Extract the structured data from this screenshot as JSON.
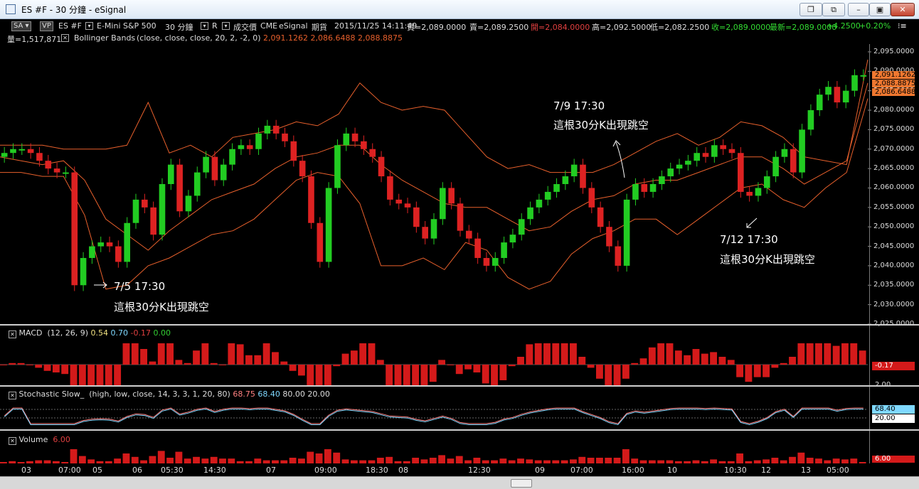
{
  "window": {
    "title": "ES #F - 30 分鐘 - eSignal"
  },
  "header": {
    "sa": "SA",
    "vp": "VP",
    "symbol": "ES #F",
    "name": "E-Mini S&P 500",
    "interval": "30 分鐘",
    "r": "R",
    "kind": "成交價",
    "exchange": "CME",
    "source": "eSignal",
    "type": "期貨",
    "datetime": "2015/11/25  14:11:49",
    "bid": "買=2,089.0000",
    "ask": "賣=2,089.2500",
    "open": "開=2,084.0000",
    "high": "高=2,092.5000",
    "low": "低=2,082.2500",
    "close": "收=2,089.0000",
    "last": "最新=2,089.0000",
    "change": "+4.2500",
    "pct": "+0.20%",
    "volume": "量=1,517,871",
    "bb_name": "Bollinger Bands",
    "bb_params": "(close, close, close, 20, 2, -2, 0)",
    "bb_values": "2,091.1262  2,086.6488  2,088.8875"
  },
  "price_axis": [
    "2,095.0000",
    "2,090.0000",
    "2,085.0000",
    "2,080.0000",
    "2,075.0000",
    "2,070.0000",
    "2,065.0000",
    "2,060.0000",
    "2,055.0000",
    "2,050.0000",
    "2,045.0000",
    "2,040.0000",
    "2,035.0000",
    "2,030.0000",
    "2,025.0000"
  ],
  "price_tags": [
    "2,091.1262",
    "2,088.8875",
    "2,086.6488"
  ],
  "annotations": [
    {
      "date": "7/5 17:30",
      "text": "這根30分K出現跳空"
    },
    {
      "date": "7/9 17:30",
      "text": "這根30分K出現跳空"
    },
    {
      "date": "7/12 17:30",
      "text": "這根30分K出現跳空"
    }
  ],
  "macd": {
    "name": "MACD",
    "params": "(12, 26, 9)",
    "v1": "0.54",
    "v2": "0.70",
    "v3": "-0.17",
    "v4": "0.00",
    "tag": "-0.17",
    "axis": "2.00"
  },
  "stoch": {
    "name": "Stochastic Slow_",
    "params": "(high, low, close, 14, 3, 3, 1, 20, 80)",
    "v1": "68.75",
    "v2": "68.40",
    "v3": "80.00",
    "v4": "20.00",
    "tag1": "68.40",
    "tag2": "20.00"
  },
  "volume_pane": {
    "name": "Volume",
    "value": "6.00",
    "tag": "6.00"
  },
  "time_axis": [
    "03",
    "07:00",
    "05",
    "06",
    "05:30",
    "14:30",
    "07",
    "09:00",
    "18:30",
    "08",
    "12:30",
    "09",
    "07:00",
    "16:00",
    "10",
    "10:30",
    "12",
    "13",
    "05:00"
  ],
  "colors": {
    "up": "#22cc22",
    "down": "#dd2222",
    "band": "#e8602c",
    "macd": "#d41a1a",
    "stoch1": "#ff8080",
    "stoch2": "#7fd8ff"
  },
  "chart_data": {
    "type": "candlestick",
    "y_range": [
      2025,
      2097
    ],
    "bands": [
      {
        "name": "upper",
        "values": [
          2071,
          2071,
          2071,
          2070,
          2070,
          2070,
          2071,
          2082,
          2069,
          2071,
          2068,
          2073,
          2074,
          2075,
          2077,
          2076,
          2079,
          2087,
          2082,
          2080,
          2081,
          2080,
          2074,
          2068,
          2065,
          2066,
          2064,
          2064,
          2064,
          2066,
          2069,
          2072,
          2074,
          2071,
          2073,
          2077,
          2076,
          2073,
          2068,
          2067,
          2066,
          2093
        ]
      },
      {
        "name": "mid",
        "values": [
          2068,
          2067,
          2066,
          2067,
          2062,
          2052,
          2048,
          2044,
          2049,
          2053,
          2057,
          2059,
          2061,
          2065,
          2068,
          2069,
          2071,
          2071,
          2066,
          2062,
          2059,
          2056,
          2055,
          2055,
          2052,
          2049,
          2050,
          2054,
          2057,
          2058,
          2061,
          2062,
          2062,
          2064,
          2066,
          2068,
          2068,
          2065,
          2061,
          2064,
          2067,
          2087
        ]
      },
      {
        "name": "lower",
        "values": [
          2064,
          2064,
          2063,
          2063,
          2053,
          2034,
          2035,
          2040,
          2042,
          2045,
          2048,
          2049,
          2052,
          2057,
          2062,
          2064,
          2063,
          2056,
          2040,
          2040,
          2042,
          2039,
          2046,
          2044,
          2037,
          2034,
          2036,
          2043,
          2047,
          2049,
          2052,
          2052,
          2048,
          2052,
          2056,
          2060,
          2061,
          2057,
          2055,
          2060,
          2064,
          2083
        ]
      }
    ],
    "closes": [
      2069,
      2070,
      2070,
      2069,
      2067,
      2065,
      2064,
      2064,
      2035,
      2042,
      2045,
      2046,
      2045,
      2041,
      2051,
      2057,
      2055,
      2048,
      2061,
      2066,
      2054,
      2058,
      2064,
      2068,
      2062,
      2066,
      2070,
      2071,
      2070,
      2074,
      2076,
      2074,
      2072,
      2067,
      2063,
      2051,
      2041,
      2060,
      2071,
      2074,
      2072,
      2070,
      2068,
      2063,
      2057,
      2056,
      2055,
      2050,
      2047,
      2052,
      2060,
      2056,
      2049,
      2047,
      2042,
      2040,
      2042,
      2046,
      2048,
      2052,
      2055,
      2057,
      2059,
      2061,
      2063,
      2066,
      2060,
      2055,
      2050,
      2045,
      2040,
      2057,
      2061,
      2059,
      2061,
      2063,
      2065,
      2066,
      2067,
      2069,
      2068,
      2071,
      2070,
      2069,
      2059,
      2058,
      2060,
      2063,
      2068,
      2070,
      2064,
      2075,
      2080,
      2084,
      2086,
      2082,
      2085,
      2089,
      2089
    ]
  }
}
